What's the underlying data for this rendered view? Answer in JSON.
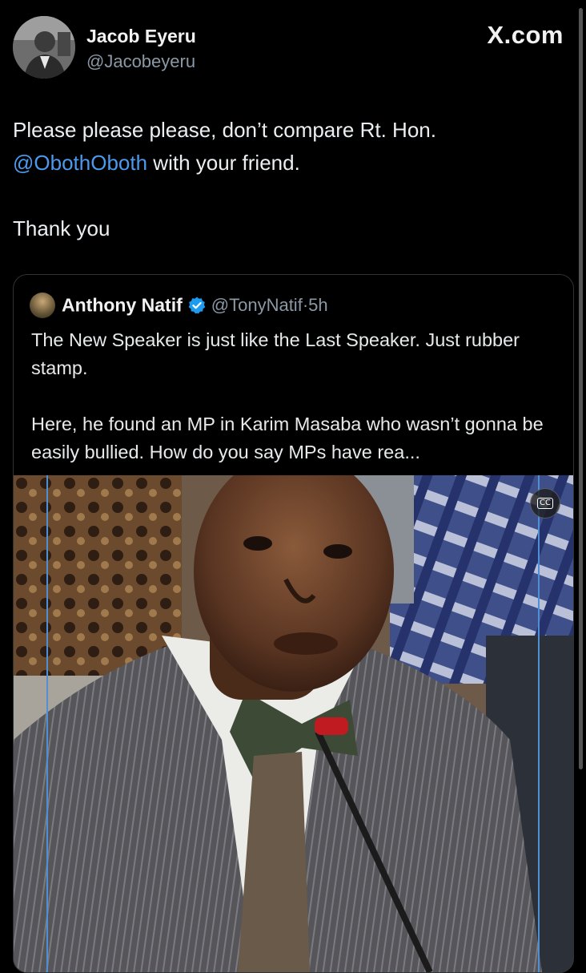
{
  "author": {
    "name": "Jacob Eyeru",
    "handle": "@Jacobeyeru",
    "avatar_icon": "user-avatar"
  },
  "site": {
    "label": "X.com"
  },
  "tweet": {
    "line1": "Please please please, don’t compare Rt. Hon.",
    "mention": "@ObothOboth",
    "line2_rest": " with your friend.",
    "line3": "Thank you"
  },
  "quote": {
    "name": "Anthony Natif",
    "verified_icon": "verified-badge-icon",
    "handle": "@TonyNatif",
    "separator": "·",
    "time": "5h",
    "para1": "The New Speaker is just like the Last Speaker. Just rubber stamp.",
    "para2": "Here, he found an MP in Karim Masaba who wasn’t gonna be easily bullied. How do you say MPs have rea..."
  },
  "media": {
    "cc_label": "CC",
    "cc_icon": "closed-captions-icon"
  },
  "colors": {
    "background": "#000000",
    "text": "#e7e9ea",
    "muted": "#8b98a5",
    "link": "#4c9aed",
    "verified": "#1d9bf0",
    "border": "#2f3336"
  }
}
